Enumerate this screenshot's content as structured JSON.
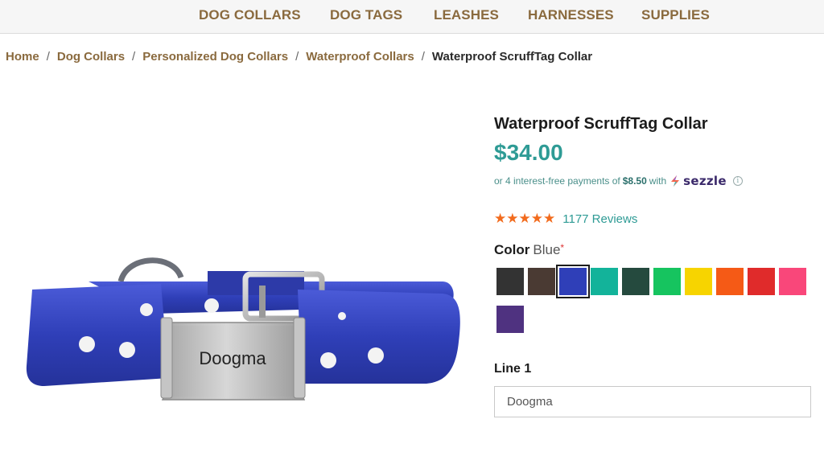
{
  "nav": {
    "items": [
      {
        "label": "DOG COLLARS"
      },
      {
        "label": "DOG TAGS"
      },
      {
        "label": "LEASHES"
      },
      {
        "label": "HARNESSES"
      },
      {
        "label": "SUPPLIES"
      }
    ]
  },
  "breadcrumb": {
    "links": [
      "Home",
      "Dog Collars",
      "Personalized Dog Collars",
      "Waterproof Collars"
    ],
    "separator": "/",
    "current": "Waterproof ScruffTag Collar"
  },
  "product": {
    "title": "Waterproof ScruffTag Collar",
    "price": "$34.00",
    "tag_engraving": "Doogma",
    "collar_color": "#2f3fb8"
  },
  "sezzle": {
    "prefix": "or 4 interest-free payments of",
    "amount": "$8.50",
    "suffix": "with",
    "brand": "sezzle",
    "info": "i"
  },
  "rating": {
    "stars": 5,
    "star_glyph": "★",
    "reviews": "1177 Reviews",
    "star_color": "#f26b1d"
  },
  "color_option": {
    "label": "Color",
    "selected": "Blue",
    "required_mark": "*",
    "swatches": [
      {
        "color": "#333333"
      },
      {
        "color": "#4a3a33"
      },
      {
        "color": "#2f3fb8",
        "selected": true
      },
      {
        "color": "#13b39a"
      },
      {
        "color": "#254a3e"
      },
      {
        "color": "#16c45f"
      },
      {
        "color": "#f7d400"
      },
      {
        "color": "#f55a16"
      },
      {
        "color": "#e02b2b"
      },
      {
        "color": "#f9477a"
      },
      {
        "color": "#4f3280"
      }
    ]
  },
  "line1": {
    "label": "Line 1",
    "value": "Doogma"
  },
  "theme": {
    "accent": "#2e9b95",
    "nav_brown": "#8a6a3e"
  }
}
